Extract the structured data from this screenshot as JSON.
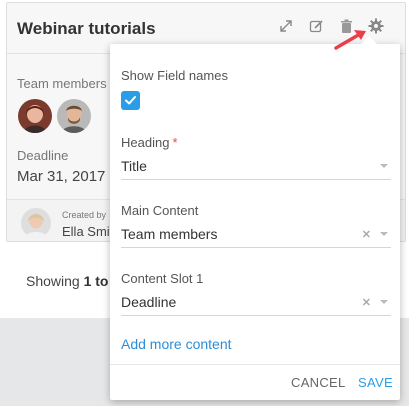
{
  "card": {
    "title": "Webinar tutorials",
    "team_members_label": "Team members",
    "deadline_label": "Deadline",
    "deadline_value": "Mar 31, 2017",
    "created_by_label": "Created by",
    "created_by_name": "Ella Smith"
  },
  "toolbar": {
    "icons": [
      "expand-icon",
      "edit-icon",
      "trash-icon",
      "gear-icon"
    ]
  },
  "pagination": {
    "prefix": "Showing ",
    "range": "1 to"
  },
  "popup": {
    "show_field_names_label": "Show Field names",
    "show_field_names_checked": true,
    "heading_label": "Heading",
    "heading_required_mark": "*",
    "heading_value": "Title",
    "main_content_label": "Main Content",
    "main_content_value": "Team members",
    "content_slot_label": "Content Slot 1",
    "content_slot_value": "Deadline",
    "add_more_label": "Add more content",
    "cancel_label": "CANCEL",
    "save_label": "SAVE"
  },
  "colors": {
    "accent": "#2a9de6",
    "annotation_arrow": "#e8404a"
  }
}
